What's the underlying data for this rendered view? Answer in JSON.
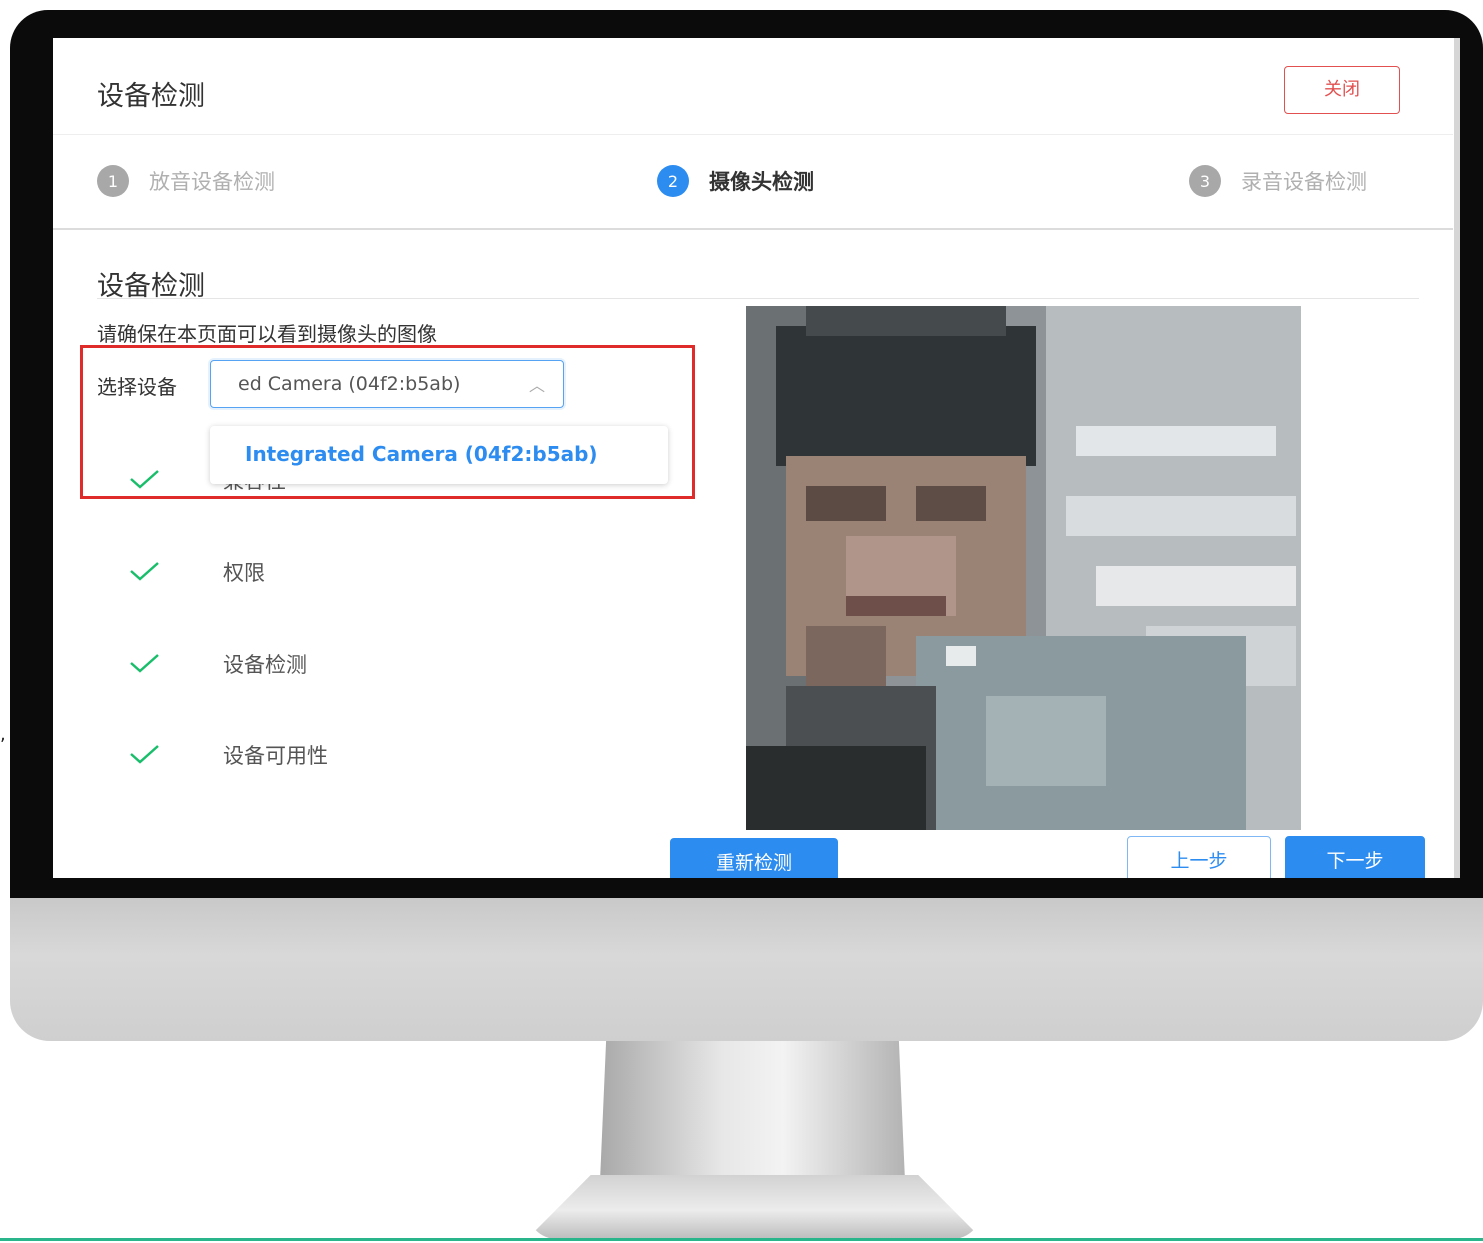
{
  "dialog": {
    "title": "设备检测",
    "close_label": "关闭"
  },
  "steps": [
    {
      "number": "1",
      "label": "放音设备检测",
      "state": "inactive"
    },
    {
      "number": "2",
      "label": "摄像头检测",
      "state": "active"
    },
    {
      "number": "3",
      "label": "录音设备检测",
      "state": "inactive"
    }
  ],
  "section": {
    "title": "设备检测",
    "instruction": "请确保在本页面可以看到摄像头的图像",
    "select_label": "选择设备",
    "select_value": "ed Camera (04f2:b5ab)",
    "dropdown_options": [
      "Integrated Camera (04f2:b5ab)"
    ]
  },
  "checks": [
    {
      "label": "兼容性",
      "status": "pass"
    },
    {
      "label": "权限",
      "status": "pass"
    },
    {
      "label": "设备检测",
      "status": "pass"
    },
    {
      "label": "设备可用性",
      "status": "pass"
    }
  ],
  "buttons": {
    "retest": "重新检测",
    "prev": "上一步",
    "next": "下一步"
  },
  "colors": {
    "primary": "#2d8cf0",
    "danger": "#e25050",
    "success": "#19be6b",
    "highlight": "#e02b2b"
  }
}
